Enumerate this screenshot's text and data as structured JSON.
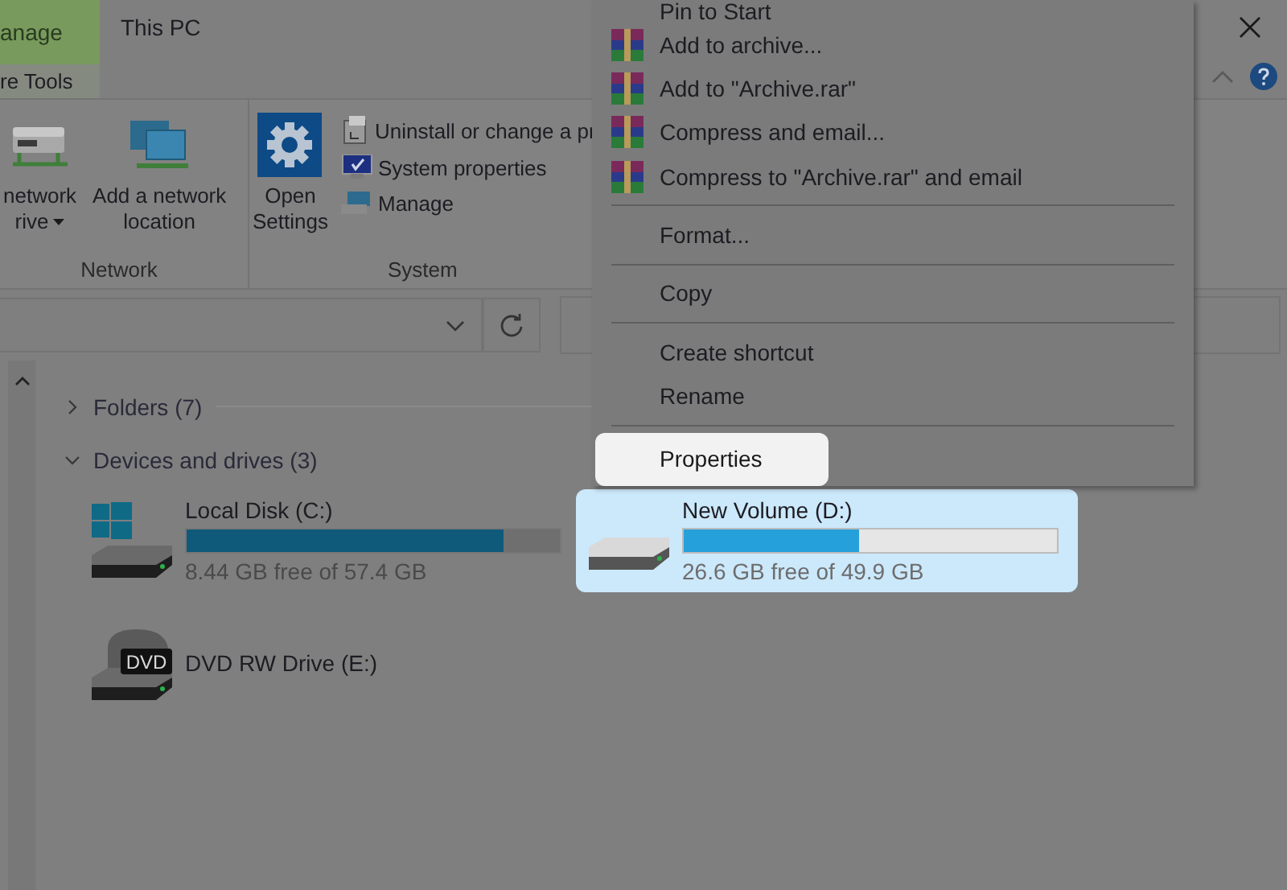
{
  "window": {
    "context_tab": {
      "label": "anage",
      "group": "re Tools"
    },
    "title": "This PC"
  },
  "ribbon": {
    "groups": [
      {
        "label": "Network",
        "items": [
          {
            "kind": "large",
            "label": "network",
            "label2": "rive",
            "dropdown": true
          },
          {
            "kind": "large",
            "label": "Add a network",
            "label2": "location",
            "dropdown": false
          }
        ]
      },
      {
        "label": "System",
        "items": [
          {
            "kind": "large",
            "label": "Open",
            "label2": "Settings",
            "dropdown": false
          },
          {
            "kind": "small",
            "label": "Uninstall or change a pr"
          },
          {
            "kind": "small",
            "label": "System properties"
          },
          {
            "kind": "small",
            "label": "Manage"
          }
        ]
      }
    ]
  },
  "sections": [
    {
      "label": "Folders (7)",
      "expanded": false
    },
    {
      "label": "Devices and drives (3)",
      "expanded": true
    }
  ],
  "drives": [
    {
      "kind": "system",
      "name": "Local Disk (C:)",
      "level": 0.85,
      "free": "8.44 GB free of 57.4 GB",
      "selected": false
    },
    {
      "kind": "disk",
      "name": "New Volume (D:)",
      "level": 0.47,
      "free": "26.6 GB free of 49.9 GB",
      "selected": true
    },
    {
      "kind": "dvd",
      "name": "DVD RW Drive (E:)",
      "badge": "DVD",
      "selected": false
    }
  ],
  "context_menu": {
    "items": [
      {
        "kind": "plain",
        "label": "Pin to Start",
        "selected": false
      },
      {
        "kind": "archive",
        "label": "Add to archive...",
        "selected": false
      },
      {
        "kind": "archive",
        "label": "Add to \"Archive.rar\"",
        "selected": false
      },
      {
        "kind": "archive",
        "label": "Compress and email...",
        "selected": false
      },
      {
        "kind": "archive",
        "label": "Compress to \"Archive.rar\" and email",
        "selected": false
      },
      {
        "kind": "separator"
      },
      {
        "kind": "plain",
        "label": "Format...",
        "selected": false
      },
      {
        "kind": "separator"
      },
      {
        "kind": "plain",
        "label": "Copy",
        "selected": false
      },
      {
        "kind": "separator"
      },
      {
        "kind": "plain",
        "label": "Create shortcut",
        "selected": false
      },
      {
        "kind": "plain",
        "label": "Rename",
        "selected": false
      },
      {
        "kind": "separator"
      },
      {
        "kind": "plain",
        "label": "Properties",
        "selected": true
      }
    ]
  }
}
